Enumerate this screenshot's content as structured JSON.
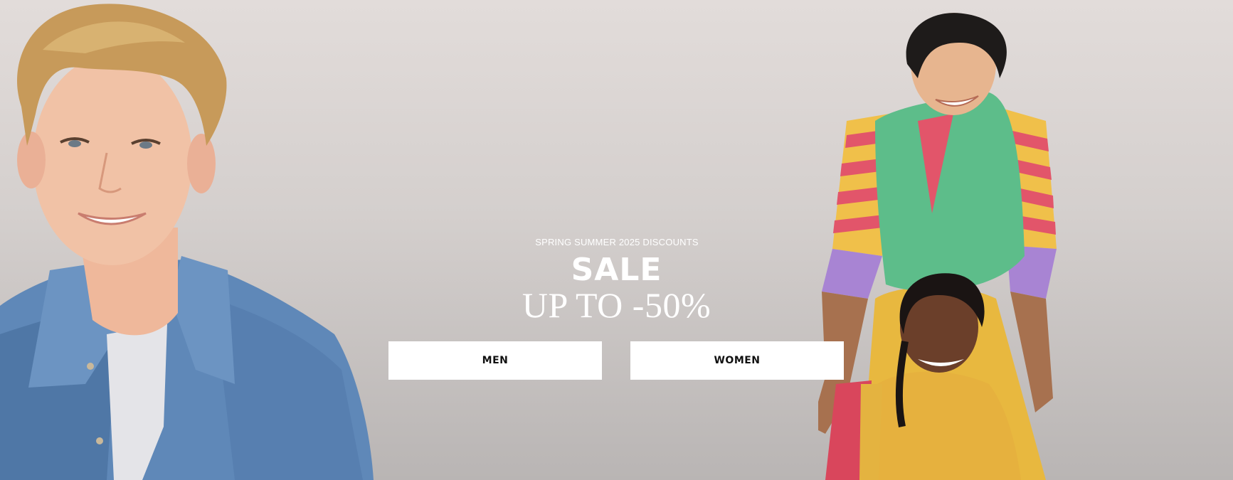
{
  "hero": {
    "eyebrow": "SPRING SUMMER 2025 DISCOUNTS",
    "title": "SALE",
    "subtitle": "UP TO -50%"
  },
  "buttons": {
    "men": "MEN",
    "women": "WOMEN"
  },
  "colors": {
    "background": "#d9d4d2",
    "button_bg": "#ffffff",
    "button_text": "#111111",
    "headline": "#ffffff"
  }
}
